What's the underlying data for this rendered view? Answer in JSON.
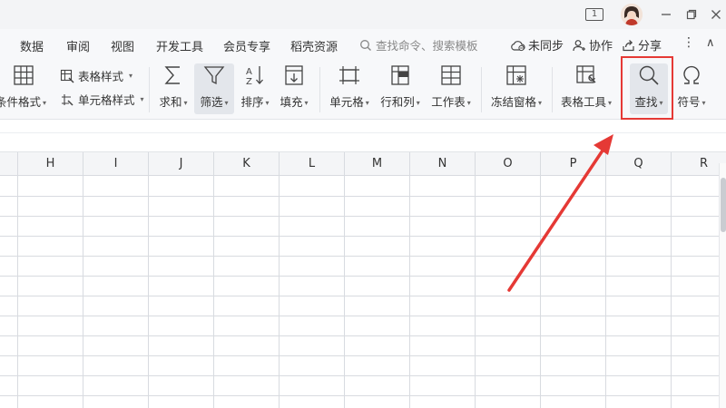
{
  "titlebar": {
    "badge": "1",
    "window_controls": [
      "minimize-icon",
      "maximize-icon",
      "close-icon"
    ]
  },
  "menu": {
    "tabs": [
      "数据",
      "审阅",
      "视图",
      "开发工具",
      "会员专享",
      "稻壳资源"
    ],
    "search_placeholder": "查找命令、搜索模板",
    "sync_label": "未同步",
    "collab_label": "协作",
    "share_label": "分享"
  },
  "ribbon": {
    "conditional_format": "条件格式",
    "table_style": "表格样式",
    "cell_style": "单元格样式",
    "sum": "求和",
    "filter": "筛选",
    "sort": "排序",
    "fill": "填充",
    "cell": "单元格",
    "rows_cols": "行和列",
    "worksheet": "工作表",
    "freeze": "冻结窗格",
    "table_tools": "表格工具",
    "find": "查找",
    "symbol": "符号"
  },
  "grid": {
    "columns": [
      "H",
      "I",
      "J",
      "K",
      "L",
      "M",
      "N",
      "O",
      "P",
      "Q",
      "R"
    ]
  },
  "colors": {
    "annotation": "#e53935",
    "ribbon_bg": "#f7f8fa",
    "grid_line": "#d8dbe0"
  }
}
